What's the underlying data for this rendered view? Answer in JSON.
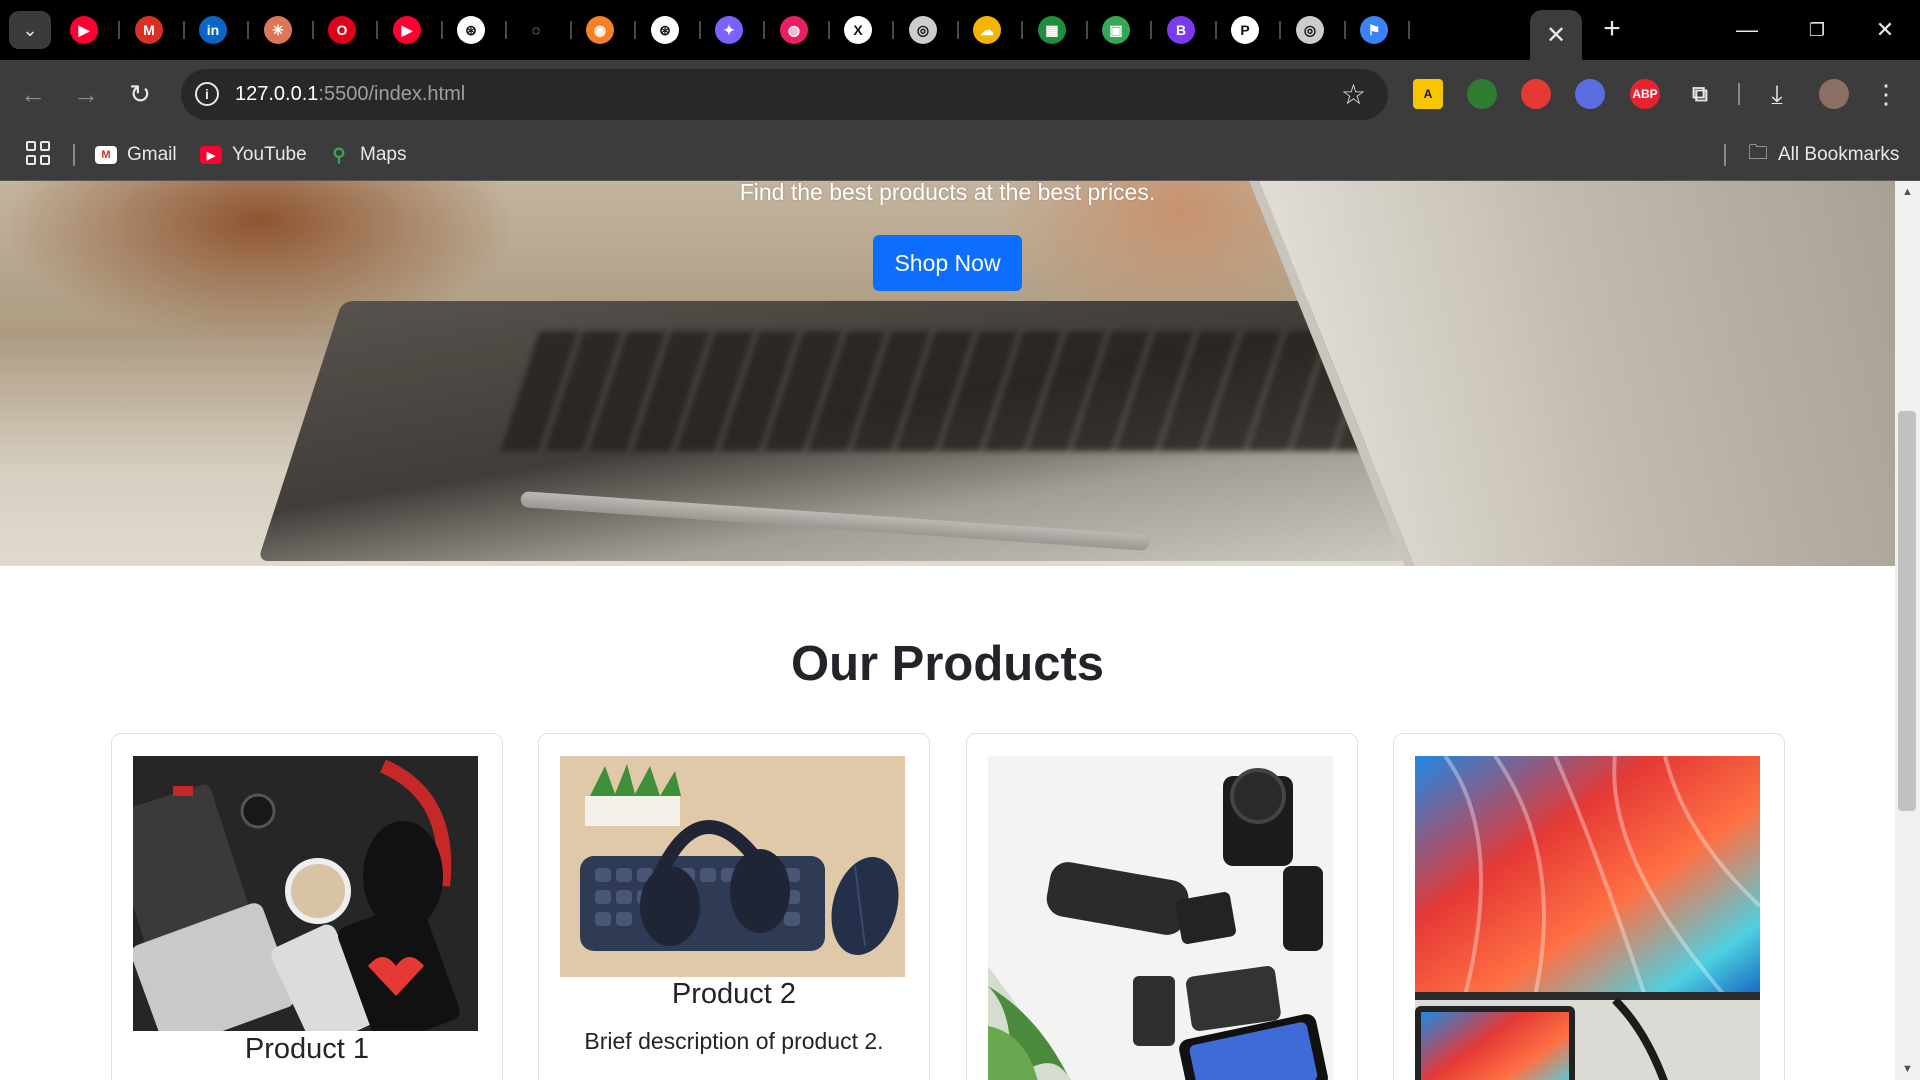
{
  "browser": {
    "address_host": "127.0.0.1",
    "address_rest": ":5500/index.html",
    "bookmarks": [
      {
        "label": "Gmail",
        "icon": "gmail-icon"
      },
      {
        "label": "YouTube",
        "icon": "youtube-icon"
      },
      {
        "label": "Maps",
        "icon": "maps-icon"
      }
    ],
    "all_bookmarks_label": "All Bookmarks",
    "extensions": [
      {
        "name": "ext-a-icon",
        "color": "#f7c600",
        "text": "A"
      },
      {
        "name": "ext-globe-icon",
        "color": "#2e7d32",
        "text": ""
      },
      {
        "name": "ext-pokeball-icon",
        "color": "#e53935",
        "text": ""
      },
      {
        "name": "ext-rocket-icon",
        "color": "#5b6ee1",
        "text": ""
      },
      {
        "name": "ext-abp-icon",
        "color": "#e8222e",
        "text": "ABP"
      },
      {
        "name": "extensions-icon",
        "color": "transparent",
        "text": "⧉"
      }
    ],
    "tabs": [
      {
        "name": "tab-youtube-icon",
        "color": "#ff0033",
        "text": "▶"
      },
      {
        "name": "tab-gmail-icon",
        "color": "#d93025",
        "text": "M"
      },
      {
        "name": "tab-linkedin-icon",
        "color": "#0a66c2",
        "text": "in"
      },
      {
        "name": "tab-claude-icon",
        "color": "#d97757",
        "text": "✳"
      },
      {
        "name": "tab-opera-icon",
        "color": "#e3001b",
        "text": "O"
      },
      {
        "name": "tab-youtube-2-icon",
        "color": "#ff0033",
        "text": "▶"
      },
      {
        "name": "tab-chatgpt-icon",
        "color": "#ffffff",
        "text": "⊛"
      },
      {
        "name": "tab-loading-icon",
        "color": "transparent",
        "text": "◌"
      },
      {
        "name": "tab-orange-icon",
        "color": "#f58025",
        "text": "◉"
      },
      {
        "name": "tab-chatgpt-2-icon",
        "color": "#ffffff",
        "text": "⊛"
      },
      {
        "name": "tab-colorful-icon",
        "color": "#7b61ff",
        "text": "✦"
      },
      {
        "name": "tab-pink-icon",
        "color": "#e91e63",
        "text": "◍"
      },
      {
        "name": "tab-x-icon",
        "color": "#ffffff",
        "text": "X"
      },
      {
        "name": "tab-globe-icon",
        "color": "#cccccc",
        "text": "◎"
      },
      {
        "name": "tab-weather-icon",
        "color": "#f4b400",
        "text": "☁"
      },
      {
        "name": "tab-green-icon",
        "color": "#1e8e3e",
        "text": "▦"
      },
      {
        "name": "tab-meet-icon",
        "color": "#34a853",
        "text": "▣"
      },
      {
        "name": "tab-b-icon",
        "color": "#7c3aed",
        "text": "B"
      },
      {
        "name": "tab-p-icon",
        "color": "#ffffff",
        "text": "P"
      },
      {
        "name": "tab-globe-2-icon",
        "color": "#cccccc",
        "text": "◎"
      },
      {
        "name": "tab-flag-icon",
        "color": "#3b82f6",
        "text": "⚑"
      }
    ]
  },
  "page": {
    "hero_subtitle": "Find the best products at the best prices.",
    "hero_button": "Shop Now",
    "section_title": "Our Products",
    "products": [
      {
        "title": "Product 1",
        "description": ""
      },
      {
        "title": "Product 2",
        "description": "Brief description of product 2."
      },
      {
        "title": "",
        "description": ""
      },
      {
        "title": "",
        "description": ""
      }
    ]
  }
}
